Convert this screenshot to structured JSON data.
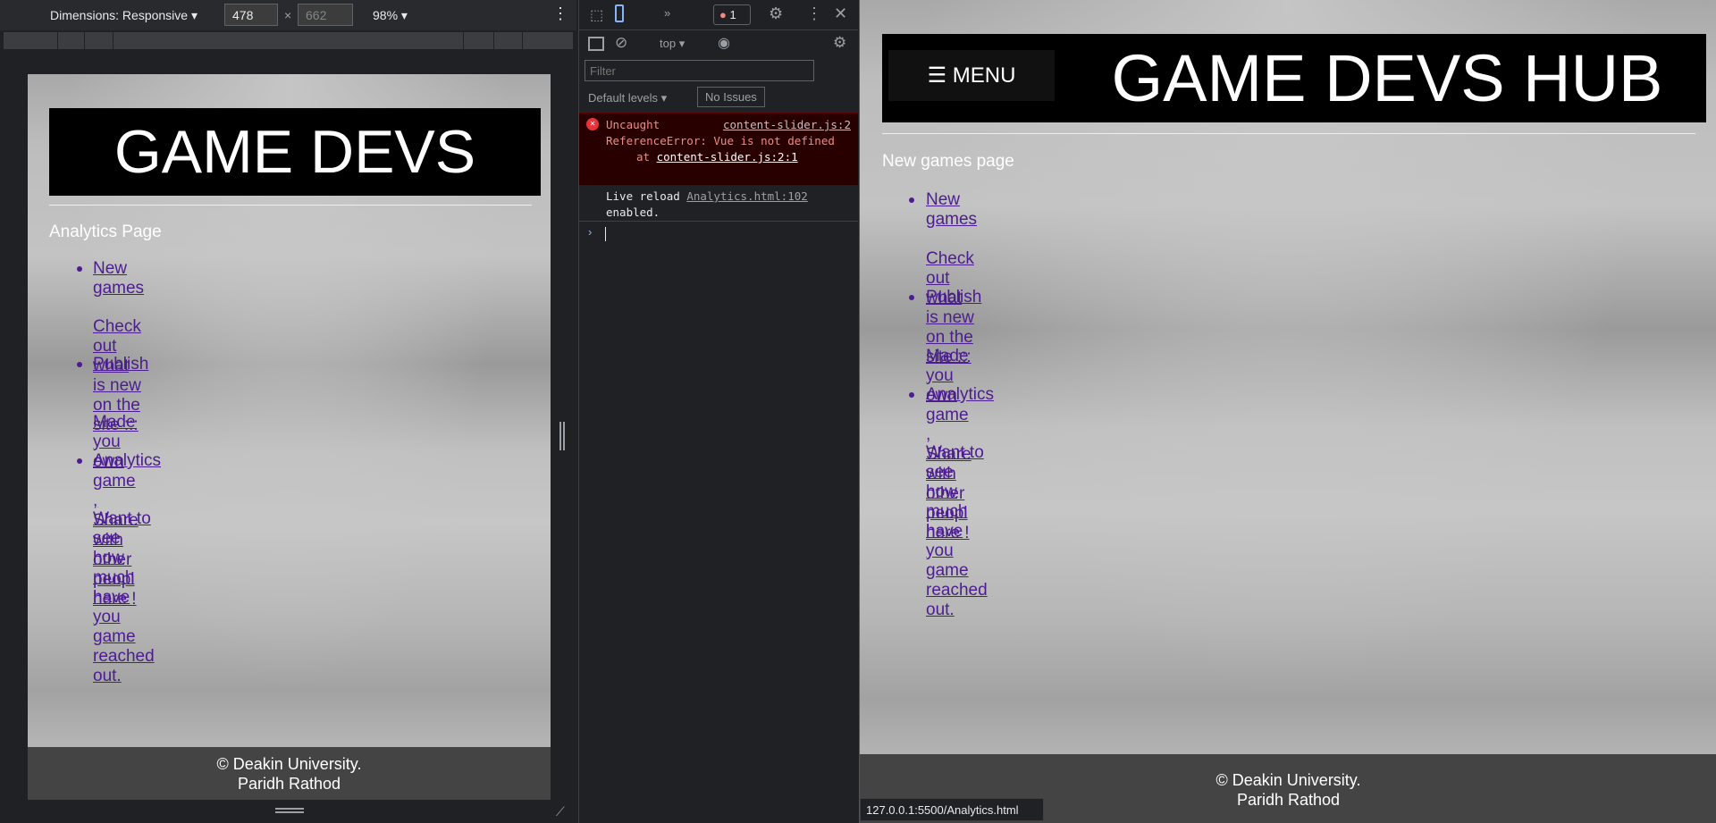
{
  "device_toolbar": {
    "dimensions_label": "Dimensions: Responsive",
    "width": "478",
    "height": "662",
    "zoom": "98%"
  },
  "device_page": {
    "title": "GAME DEVS",
    "page_label": "Analytics Page",
    "items": [
      {
        "label": "New games",
        "desc": "Check out what is new on the site :::"
      },
      {
        "label": "Publish",
        "desc": "Made you own game , Share with other peopl here !"
      },
      {
        "label": "Analytics",
        "desc": "Want to see how much have you game reached out."
      }
    ],
    "footer": [
      "© Deakin University.",
      "Paridh Rathod"
    ]
  },
  "devtools": {
    "error_count": "1",
    "context": "top",
    "filter_placeholder": "Filter",
    "levels": "Default levels",
    "issues": "No Issues",
    "error": {
      "prefix": "Uncaught",
      "source": "content-slider.js:2",
      "message": "ReferenceError: Vue is not defined",
      "at": "at",
      "at_link": "content-slider.js:2:1"
    },
    "log": {
      "text": "Live reload",
      "source": "Analytics.html:102",
      "text2": "enabled."
    }
  },
  "main_page": {
    "menu": "☰ MENU",
    "title": "GAME DEVS HUB",
    "page_label": "New games page",
    "items": [
      {
        "label": "New games",
        "desc": "Check out what is new on the site :::"
      },
      {
        "label": "Publish",
        "desc": "Made you own game , Share with other peopl here !"
      },
      {
        "label": "Analytics",
        "desc": "Want to see how much have you game reached out."
      }
    ],
    "footer": [
      "© Deakin University.",
      "Paridh Rathod"
    ]
  },
  "status_url": "127.0.0.1:5500/Analytics.html",
  "colors": {
    "link": "#4b1d8f",
    "error_bg": "#290000",
    "error_text": "#f28b82",
    "header": "#000000",
    "footer": "#444444"
  }
}
